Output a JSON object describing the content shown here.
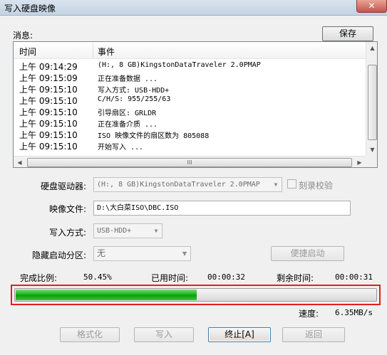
{
  "window": {
    "title": "写入硬盘映像",
    "close_glyph": "✕"
  },
  "message_label": "消息:",
  "save_button": "保存",
  "log": {
    "headers": {
      "time": "时间",
      "event": "事件"
    },
    "rows": [
      {
        "time": "上午 09:14:29",
        "event": "(H:, 8 GB)KingstonDataTraveler 2.0PMAP"
      },
      {
        "time": "上午 09:15:09",
        "event": "正在准备数据 ..."
      },
      {
        "time": "上午 09:15:10",
        "event": "写入方式: USB-HDD+"
      },
      {
        "time": "上午 09:15:10",
        "event": "C/H/S: 955/255/63"
      },
      {
        "time": "上午 09:15:10",
        "event": "引导扇区: GRLDR"
      },
      {
        "time": "上午 09:15:10",
        "event": "正在准备介质 ..."
      },
      {
        "time": "上午 09:15:10",
        "event": "ISO 映像文件的扇区数为 805088"
      },
      {
        "time": "上午 09:15:10",
        "event": "开始写入 ..."
      }
    ],
    "hscroll_grip": "III"
  },
  "form": {
    "drive_label": "硬盘驱动器:",
    "drive_value": "(H:, 8 GB)KingstonDataTraveler 2.0PMAP",
    "verify_label": "刻录校验",
    "image_label": "映像文件:",
    "image_value": "D:\\大白菜ISO\\DBC.ISO",
    "write_mode_label": "写入方式:",
    "write_mode_value": "USB-HDD+",
    "hidden_partition_label": "隐藏启动分区:",
    "hidden_partition_value": "无",
    "quick_boot_button": "便捷启动"
  },
  "status": {
    "progress_label": "完成比例:",
    "progress_value": "50.45%",
    "progress_fraction": 0.5045,
    "elapsed_label": "已用时间:",
    "elapsed_value": "00:00:32",
    "remaining_label": "剩余时间:",
    "remaining_value": "00:00:31",
    "speed_label": "速度:",
    "speed_value": "6.35MB/s"
  },
  "buttons": {
    "format": "格式化",
    "write": "写入",
    "stop": "终止[A]",
    "back": "返回"
  },
  "colors": {
    "progress_green": "#1fb21f",
    "highlight_red": "#e02020"
  }
}
